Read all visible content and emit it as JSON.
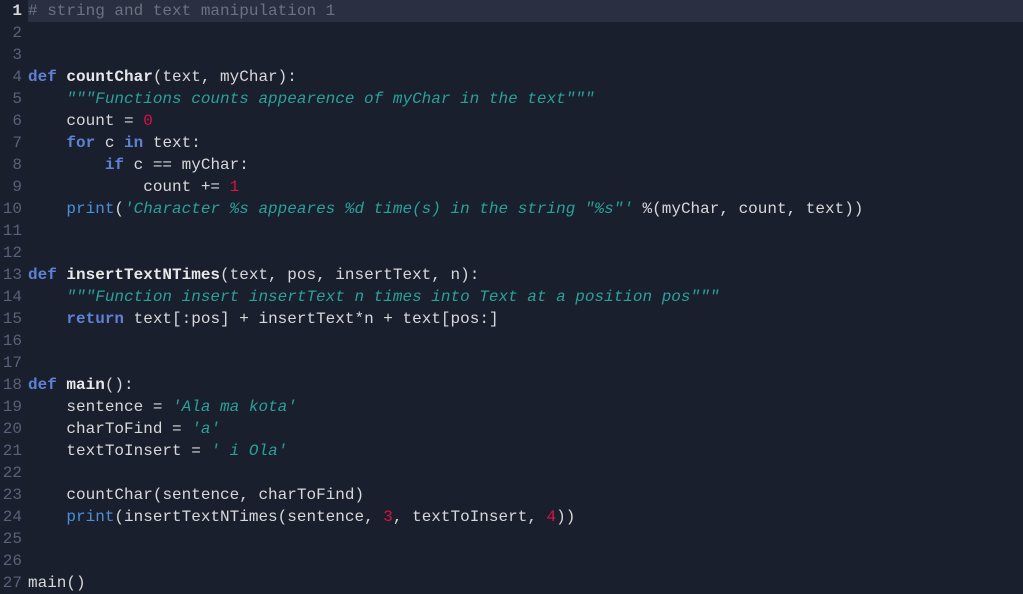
{
  "editor": {
    "current_line": 1,
    "lines": [
      {
        "n": 1,
        "tokens": [
          [
            "comment",
            "# string and text manipulation 1"
          ]
        ]
      },
      {
        "n": 2,
        "tokens": []
      },
      {
        "n": 3,
        "tokens": []
      },
      {
        "n": 4,
        "tokens": [
          [
            "keyword",
            "def "
          ],
          [
            "funcname",
            "countChar"
          ],
          [
            "punct",
            "("
          ],
          [
            "param",
            "text"
          ],
          [
            "punct",
            ", "
          ],
          [
            "param",
            "myChar"
          ],
          [
            "punct",
            "):"
          ]
        ]
      },
      {
        "n": 5,
        "tokens": [
          [
            "ident",
            "    "
          ],
          [
            "docstring",
            "\"\"\"Functions counts appearence of myChar in the text\"\"\""
          ]
        ]
      },
      {
        "n": 6,
        "tokens": [
          [
            "ident",
            "    count "
          ],
          [
            "op",
            "= "
          ],
          [
            "number",
            "0"
          ]
        ]
      },
      {
        "n": 7,
        "tokens": [
          [
            "ident",
            "    "
          ],
          [
            "keyword",
            "for"
          ],
          [
            "ident",
            " c "
          ],
          [
            "keyword",
            "in"
          ],
          [
            "ident",
            " text"
          ],
          [
            "punct",
            ":"
          ]
        ]
      },
      {
        "n": 8,
        "tokens": [
          [
            "ident",
            "        "
          ],
          [
            "keyword",
            "if"
          ],
          [
            "ident",
            " c "
          ],
          [
            "op",
            "=="
          ],
          [
            "ident",
            " myChar"
          ],
          [
            "punct",
            ":"
          ]
        ]
      },
      {
        "n": 9,
        "tokens": [
          [
            "ident",
            "            count "
          ],
          [
            "op",
            "+="
          ],
          [
            "ident",
            " "
          ],
          [
            "number",
            "1"
          ]
        ]
      },
      {
        "n": 10,
        "tokens": [
          [
            "ident",
            "    "
          ],
          [
            "builtin",
            "print"
          ],
          [
            "punct",
            "("
          ],
          [
            "string",
            "'Character %s appeares %d time(s) in the string \"%s\"'"
          ],
          [
            "ident",
            " "
          ],
          [
            "op",
            "%"
          ],
          [
            "punct",
            "("
          ],
          [
            "ident",
            "myChar"
          ],
          [
            "punct",
            ", "
          ],
          [
            "ident",
            "count"
          ],
          [
            "punct",
            ", "
          ],
          [
            "ident",
            "text"
          ],
          [
            "punct",
            "))"
          ]
        ]
      },
      {
        "n": 11,
        "tokens": []
      },
      {
        "n": 12,
        "tokens": []
      },
      {
        "n": 13,
        "tokens": [
          [
            "keyword",
            "def "
          ],
          [
            "funcname",
            "insertTextNTimes"
          ],
          [
            "punct",
            "("
          ],
          [
            "param",
            "text"
          ],
          [
            "punct",
            ", "
          ],
          [
            "param",
            "pos"
          ],
          [
            "punct",
            ", "
          ],
          [
            "param",
            "insertText"
          ],
          [
            "punct",
            ", "
          ],
          [
            "param",
            "n"
          ],
          [
            "punct",
            "):"
          ]
        ]
      },
      {
        "n": 14,
        "tokens": [
          [
            "ident",
            "    "
          ],
          [
            "docstring",
            "\"\"\"Function insert insertText n times into Text at a position pos\"\"\""
          ]
        ]
      },
      {
        "n": 15,
        "tokens": [
          [
            "ident",
            "    "
          ],
          [
            "keyword",
            "return"
          ],
          [
            "ident",
            " text"
          ],
          [
            "punct",
            "[:"
          ],
          [
            "ident",
            "pos"
          ],
          [
            "punct",
            "] "
          ],
          [
            "op",
            "+"
          ],
          [
            "ident",
            " insertText"
          ],
          [
            "op",
            "*"
          ],
          [
            "ident",
            "n "
          ],
          [
            "op",
            "+"
          ],
          [
            "ident",
            " text"
          ],
          [
            "punct",
            "["
          ],
          [
            "ident",
            "pos"
          ],
          [
            "punct",
            ":]"
          ]
        ]
      },
      {
        "n": 16,
        "tokens": []
      },
      {
        "n": 17,
        "tokens": []
      },
      {
        "n": 18,
        "tokens": [
          [
            "keyword",
            "def "
          ],
          [
            "funcname",
            "main"
          ],
          [
            "punct",
            "():"
          ]
        ]
      },
      {
        "n": 19,
        "tokens": [
          [
            "ident",
            "    sentence "
          ],
          [
            "op",
            "="
          ],
          [
            "ident",
            " "
          ],
          [
            "string",
            "'Ala ma kota'"
          ]
        ]
      },
      {
        "n": 20,
        "tokens": [
          [
            "ident",
            "    charToFind "
          ],
          [
            "op",
            "="
          ],
          [
            "ident",
            " "
          ],
          [
            "string",
            "'a'"
          ]
        ]
      },
      {
        "n": 21,
        "tokens": [
          [
            "ident",
            "    textToInsert "
          ],
          [
            "op",
            "="
          ],
          [
            "ident",
            " "
          ],
          [
            "string",
            "' i Ola'"
          ]
        ]
      },
      {
        "n": 22,
        "tokens": []
      },
      {
        "n": 23,
        "tokens": [
          [
            "ident",
            "    countChar"
          ],
          [
            "punct",
            "("
          ],
          [
            "ident",
            "sentence"
          ],
          [
            "punct",
            ", "
          ],
          [
            "ident",
            "charToFind"
          ],
          [
            "punct",
            ")"
          ]
        ]
      },
      {
        "n": 24,
        "tokens": [
          [
            "ident",
            "    "
          ],
          [
            "builtin",
            "print"
          ],
          [
            "punct",
            "("
          ],
          [
            "ident",
            "insertTextNTimes"
          ],
          [
            "punct",
            "("
          ],
          [
            "ident",
            "sentence"
          ],
          [
            "punct",
            ", "
          ],
          [
            "number",
            "3"
          ],
          [
            "punct",
            ", "
          ],
          [
            "ident",
            "textToInsert"
          ],
          [
            "punct",
            ", "
          ],
          [
            "number",
            "4"
          ],
          [
            "punct",
            "))"
          ]
        ]
      },
      {
        "n": 25,
        "tokens": []
      },
      {
        "n": 26,
        "tokens": []
      },
      {
        "n": 27,
        "tokens": [
          [
            "ident",
            "main"
          ],
          [
            "punct",
            "()"
          ]
        ]
      }
    ]
  }
}
